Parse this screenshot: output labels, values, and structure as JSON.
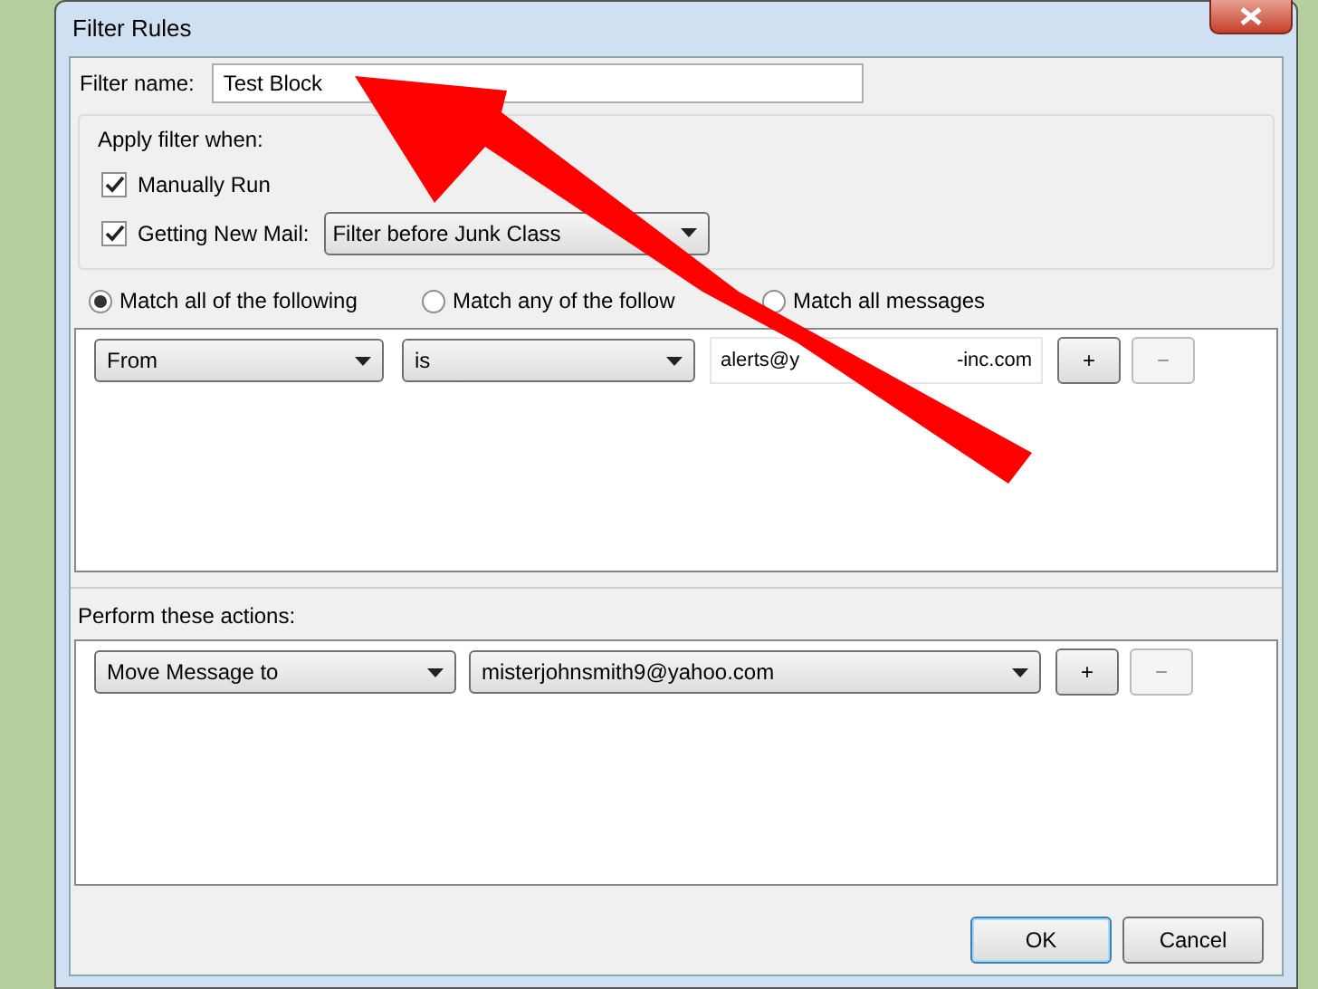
{
  "window": {
    "title": "Filter Rules"
  },
  "filter_name": {
    "label": "Filter name:",
    "value": "Test Block"
  },
  "apply_filter": {
    "label": "Apply filter when:",
    "options": [
      {
        "label": "Manually Run",
        "checked": true
      },
      {
        "label": "Getting New Mail:",
        "checked": true,
        "dropdown": "Filter before Junk Class"
      }
    ]
  },
  "match": [
    {
      "label": "Match all of the following",
      "selected": true
    },
    {
      "label": "Match any of the follow",
      "selected": false
    },
    {
      "label": "Match all messages",
      "selected": false
    }
  ],
  "rules": [
    {
      "field": "From",
      "operator": "is",
      "value_parts": [
        "alerts@y",
        "-inc.com"
      ],
      "add": "+",
      "remove": "−",
      "remove_disabled": true
    }
  ],
  "actions_label": "Perform these actions:",
  "actions": [
    {
      "action": "Move Message to",
      "target": "misterjohnsmith9@yahoo.com",
      "add": "+",
      "remove": "−",
      "remove_disabled": true
    }
  ],
  "buttons": [
    {
      "label": "OK",
      "default": true
    },
    {
      "label": "Cancel",
      "default": false
    }
  ]
}
